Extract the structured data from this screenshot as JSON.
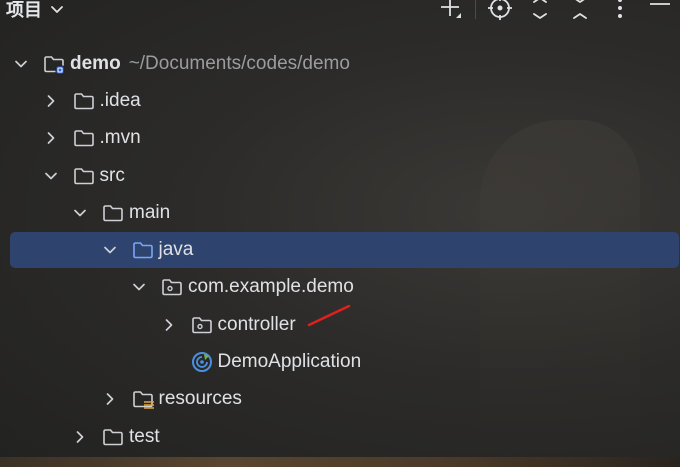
{
  "header": {
    "title": "项目"
  },
  "tree": [
    {
      "id": "demo",
      "label": "demo",
      "path": "~/Documents/codes/demo",
      "level": 0,
      "expanded": true,
      "icon": "module-folder-icon",
      "bold": true
    },
    {
      "id": "idea",
      "label": ".idea",
      "level": 1,
      "expanded": false,
      "icon": "folder-icon"
    },
    {
      "id": "mvn",
      "label": ".mvn",
      "level": 1,
      "expanded": false,
      "icon": "folder-icon"
    },
    {
      "id": "src",
      "label": "src",
      "level": 1,
      "expanded": true,
      "icon": "folder-icon"
    },
    {
      "id": "main",
      "label": "main",
      "level": 2,
      "expanded": true,
      "icon": "folder-icon"
    },
    {
      "id": "java",
      "label": "java",
      "level": 3,
      "expanded": true,
      "icon": "source-folder-icon",
      "selected": true
    },
    {
      "id": "com-example-demo",
      "label": "com.example.demo",
      "level": 4,
      "expanded": true,
      "icon": "package-icon"
    },
    {
      "id": "controller",
      "label": "controller",
      "level": 5,
      "expanded": false,
      "icon": "package-icon"
    },
    {
      "id": "demo-application",
      "label": "DemoApplication",
      "level": 5,
      "leaf": true,
      "icon": "spring-boot-app-icon"
    },
    {
      "id": "resources",
      "label": "resources",
      "level": 3,
      "expanded": false,
      "icon": "resources-folder-icon"
    },
    {
      "id": "test",
      "label": "test",
      "level": 2,
      "expanded": false,
      "icon": "folder-icon"
    }
  ],
  "colors": {
    "selection": "#2e436e",
    "text": "#dfe1e5",
    "path_text": "#9a9ca1",
    "annotation": "#e0201c",
    "spring_icon": "#4a90e2"
  }
}
